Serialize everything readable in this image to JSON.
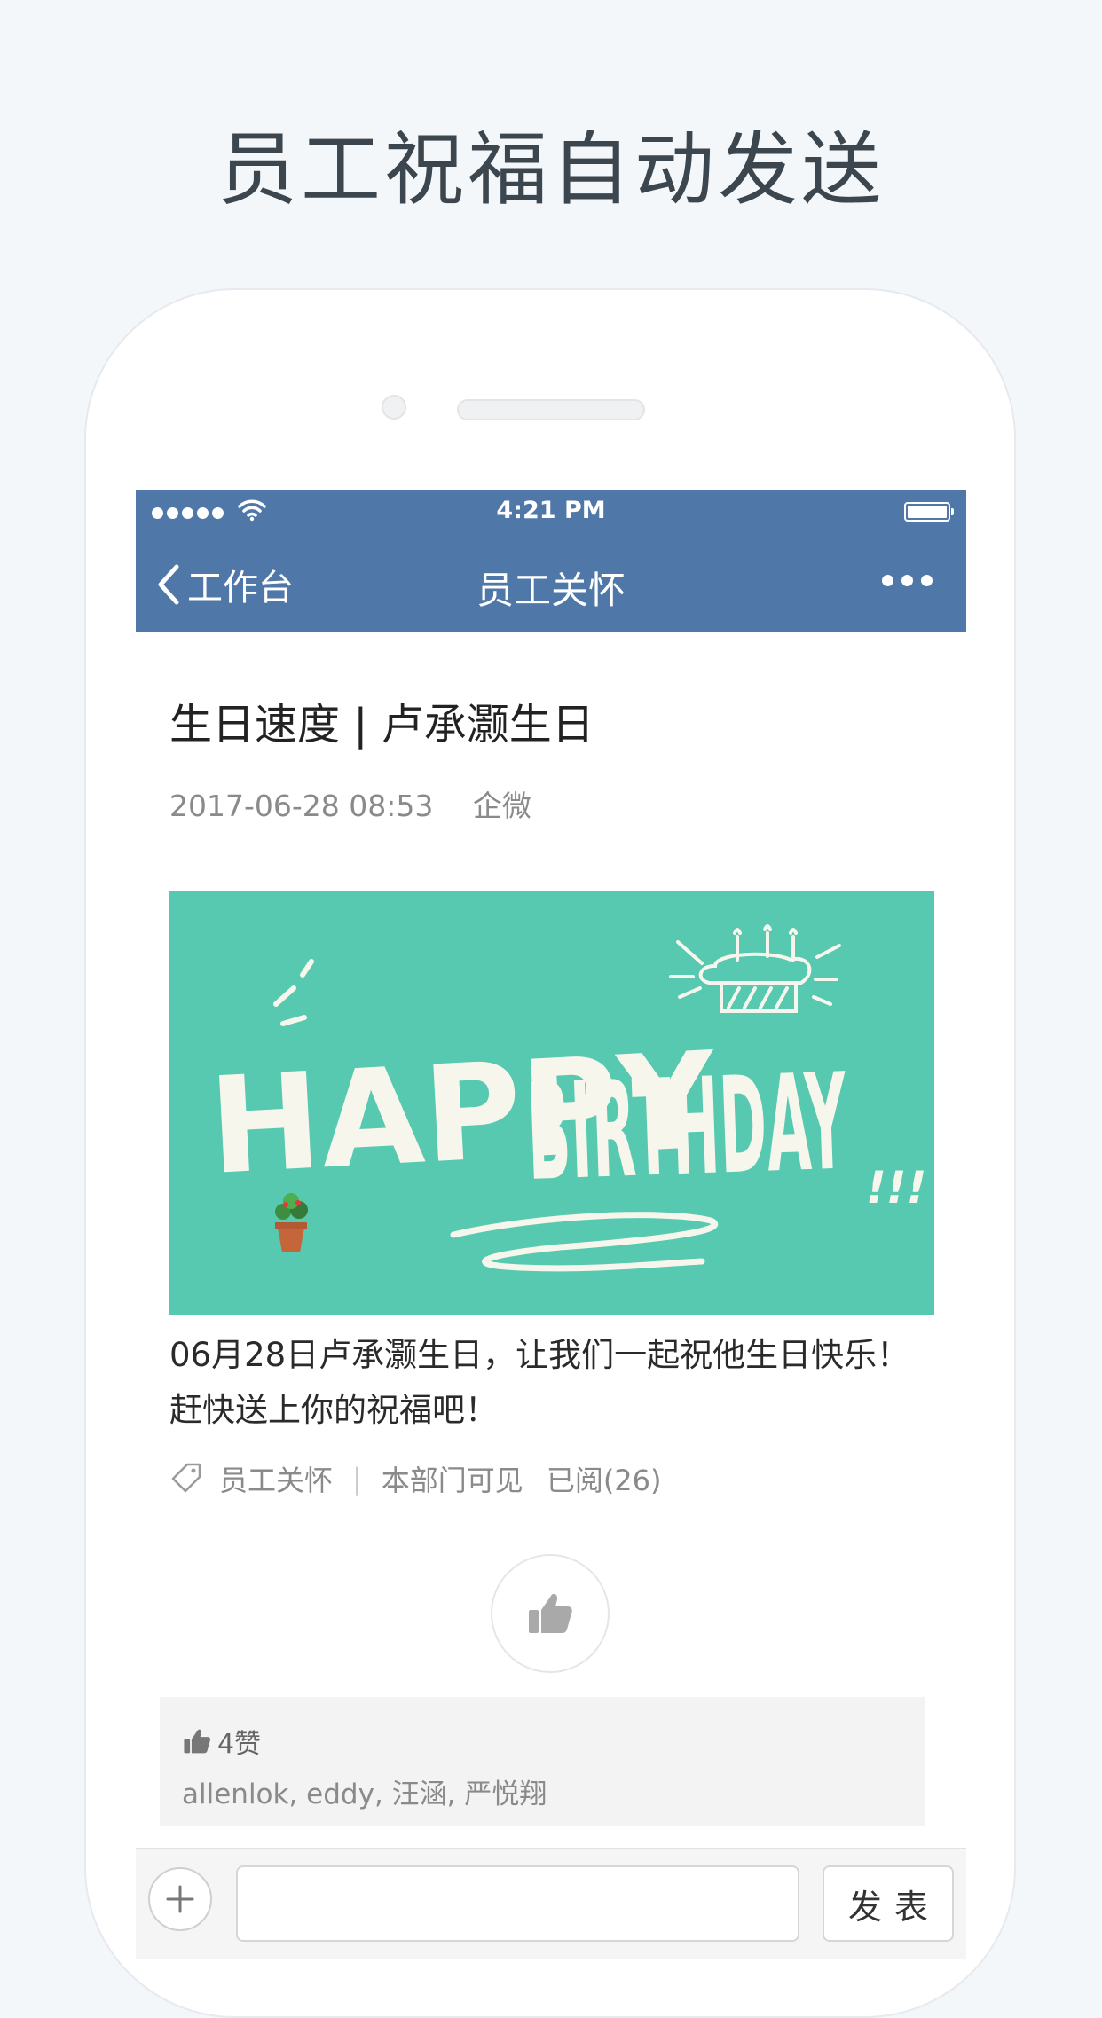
{
  "headline": "员工祝福自动发送",
  "status_bar": {
    "time": "4:21 PM"
  },
  "nav": {
    "back_label": "工作台",
    "title": "员工关怀"
  },
  "post": {
    "title": "生日速度 | 卢承灏生日",
    "datetime": "2017-06-28 08:53",
    "source": "企微",
    "banner": {
      "text_line1": "HAPPY",
      "text_line2": "BIRTHDAY",
      "exclaim": "!!!"
    },
    "body": "06月28日卢承灏生日，让我们一起祝他生日快乐！赶快送上你的祝福吧！",
    "tag": "员工关怀",
    "visibility": "本部门可见",
    "read_count": "已阅(26)"
  },
  "likes": {
    "count": "4赞",
    "names": "allenlok, eddy, 汪涵, 严悦翔"
  },
  "composer": {
    "placeholder": "",
    "send_label": "发表"
  },
  "colors": {
    "nav_bar": "#4f78a8",
    "banner_bg": "#56c9b0",
    "page_bg": "#f4f7fa"
  }
}
